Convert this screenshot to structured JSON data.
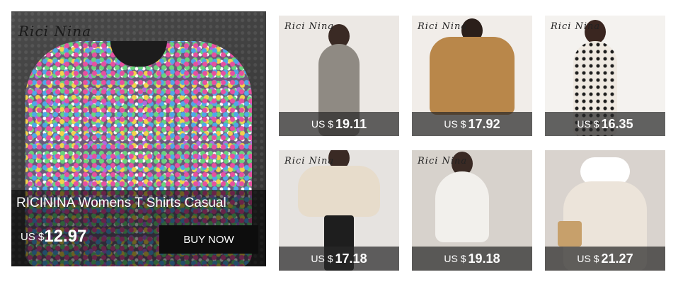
{
  "hero": {
    "brand": "Rici Nina",
    "title": "RICININA Womens T Shirts Casual",
    "currency": "US $",
    "price": "12.97",
    "buy_label": "BUY NOW"
  },
  "products": [
    {
      "brand": "Rici Nina",
      "currency": "US $",
      "price": "19.11",
      "garment": "grey-knit-dress",
      "bg": "#ece8e4",
      "cloth": "#8f8a83"
    },
    {
      "brand": "Rici Nina",
      "currency": "US $",
      "price": "17.92",
      "garment": "camel-cardigan",
      "bg": "#f1ede9",
      "cloth": "#b9874a"
    },
    {
      "brand": "Rici Nina",
      "currency": "US $",
      "price": "16.35",
      "garment": "polka-dot-dress",
      "bg": "#f4f2ef",
      "cloth": "#efe9e1"
    },
    {
      "brand": "Rici Nina",
      "currency": "US $",
      "price": "17.18",
      "garment": "cream-wrap-sweater",
      "bg": "#e6e3e0",
      "cloth": "#e7dccb"
    },
    {
      "brand": "Rici Nina",
      "currency": "US $",
      "price": "19.18",
      "garment": "white-hoodie-dress",
      "bg": "#d7d2cc",
      "cloth": "#f2f0ec"
    },
    {
      "brand": "",
      "currency": "US $",
      "price": "21.27",
      "garment": "fur-hood-sweater",
      "bg": "#d9d3ce",
      "cloth": "#ece4da"
    }
  ]
}
